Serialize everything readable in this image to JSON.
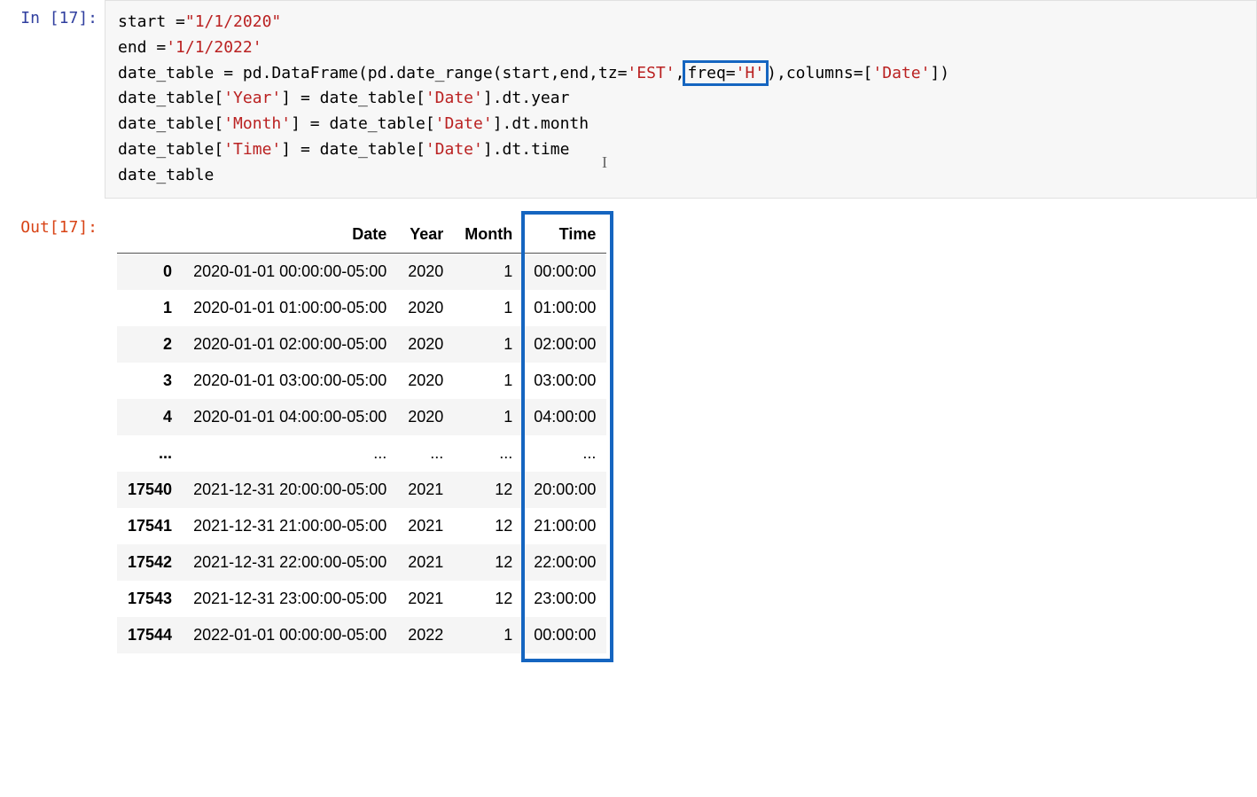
{
  "prompt": {
    "in": "In [17]:",
    "out": "Out[17]:"
  },
  "code": {
    "l1a": "start ",
    "l1b": "=",
    "l1c": "\"1/1/2020\"",
    "l2a": "end ",
    "l2b": "=",
    "l2c": "'1/1/2022'",
    "l3a": "date_table ",
    "l3b": "=",
    "l3c": " pd",
    "l3d": ".",
    "l3e": "DataFrame(pd",
    "l3f": ".",
    "l3g": "date_range(start,end,tz",
    "l3h": "=",
    "l3i": "'EST'",
    "l3j": ",",
    "l3ka": "freq",
    "l3kb": "=",
    "l3kc": "'H'",
    "l3l": "),columns",
    "l3m": "=",
    "l3n": "[",
    "l3o": "'Date'",
    "l3p": "])",
    "l4a": "date_table[",
    "l4b": "'Year'",
    "l4c": "] ",
    "l4d": "=",
    "l4e": " date_table[",
    "l4f": "'Date'",
    "l4g": "]",
    "l4h": ".",
    "l4i": "dt",
    "l4j": ".",
    "l4k": "year",
    "l5a": "date_table[",
    "l5b": "'Month'",
    "l5c": "] ",
    "l5d": "=",
    "l5e": " date_table[",
    "l5f": "'Date'",
    "l5g": "]",
    "l5h": ".",
    "l5i": "dt",
    "l5j": ".",
    "l5k": "month",
    "l6a": "date_table[",
    "l6b": "'Time'",
    "l6c": "] ",
    "l6d": "=",
    "l6e": " date_table[",
    "l6f": "'Date'",
    "l6g": "]",
    "l6h": ".",
    "l6i": "dt",
    "l6j": ".",
    "l6k": "time",
    "l7": "date_table"
  },
  "table": {
    "headers": {
      "idx": "",
      "date": "Date",
      "year": "Year",
      "month": "Month",
      "time": "Time"
    },
    "rows": [
      {
        "idx": "0",
        "date": "2020-01-01 00:00:00-05:00",
        "year": "2020",
        "month": "1",
        "time": "00:00:00"
      },
      {
        "idx": "1",
        "date": "2020-01-01 01:00:00-05:00",
        "year": "2020",
        "month": "1",
        "time": "01:00:00"
      },
      {
        "idx": "2",
        "date": "2020-01-01 02:00:00-05:00",
        "year": "2020",
        "month": "1",
        "time": "02:00:00"
      },
      {
        "idx": "3",
        "date": "2020-01-01 03:00:00-05:00",
        "year": "2020",
        "month": "1",
        "time": "03:00:00"
      },
      {
        "idx": "4",
        "date": "2020-01-01 04:00:00-05:00",
        "year": "2020",
        "month": "1",
        "time": "04:00:00"
      },
      {
        "idx": "...",
        "date": "...",
        "year": "...",
        "month": "...",
        "time": "..."
      },
      {
        "idx": "17540",
        "date": "2021-12-31 20:00:00-05:00",
        "year": "2021",
        "month": "12",
        "time": "20:00:00"
      },
      {
        "idx": "17541",
        "date": "2021-12-31 21:00:00-05:00",
        "year": "2021",
        "month": "12",
        "time": "21:00:00"
      },
      {
        "idx": "17542",
        "date": "2021-12-31 22:00:00-05:00",
        "year": "2021",
        "month": "12",
        "time": "22:00:00"
      },
      {
        "idx": "17543",
        "date": "2021-12-31 23:00:00-05:00",
        "year": "2021",
        "month": "12",
        "time": "23:00:00"
      },
      {
        "idx": "17544",
        "date": "2022-01-01 00:00:00-05:00",
        "year": "2022",
        "month": "1",
        "time": "00:00:00"
      }
    ]
  },
  "highlight": {
    "target_col": "time"
  },
  "cursor_glyph": "I"
}
